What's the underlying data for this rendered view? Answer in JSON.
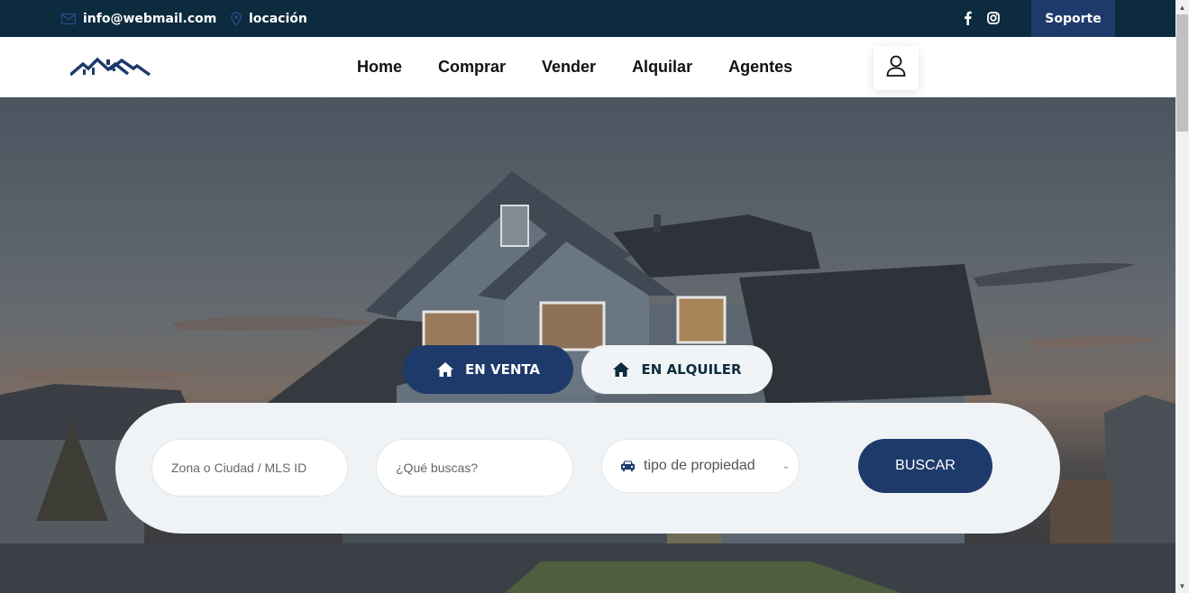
{
  "topbar": {
    "email": "info@webmail.com",
    "location": "locación",
    "support_label": "Soporte",
    "email_icon": "mail-icon",
    "location_icon": "map-pin-icon",
    "social": [
      "facebook-icon",
      "instagram-icon"
    ]
  },
  "nav": {
    "items": [
      "Home",
      "Comprar",
      "Vender",
      "Alquilar",
      "Agentes"
    ],
    "user_icon": "user-icon"
  },
  "hero": {
    "tabs": [
      {
        "label": "EN VENTA",
        "icon": "home-icon",
        "active": true
      },
      {
        "label": "EN ALQUILER",
        "icon": "home-icon",
        "active": false
      }
    ],
    "search": {
      "zone_placeholder": "Zona o Ciudad / MLS ID",
      "what_placeholder": "¿Qué buscas?",
      "property_type": "tipo de propiedad",
      "property_icon": "car-icon",
      "button_label": "BUSCAR"
    }
  },
  "colors": {
    "topbar_bg": "#0d2b3e",
    "accent": "#1e3a6b",
    "panel_bg": "#eff3f5"
  }
}
